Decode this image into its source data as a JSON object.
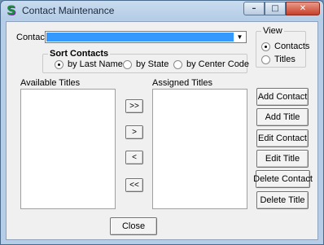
{
  "window": {
    "title": "Contact Maintenance",
    "icon": "S",
    "minimize": "–",
    "maximize": "□",
    "close": "✕"
  },
  "contact": {
    "label": "Contact:",
    "value": ""
  },
  "sort": {
    "legend": "Sort Contacts",
    "options": [
      {
        "label": "by Last Name",
        "selected": true
      },
      {
        "label": "by State",
        "selected": false
      },
      {
        "label": "by Center Code",
        "selected": false
      }
    ]
  },
  "view": {
    "legend": "View",
    "options": [
      {
        "label": "Contacts",
        "selected": true
      },
      {
        "label": "Titles",
        "selected": false
      }
    ]
  },
  "lists": {
    "available_label": "Available Titles",
    "assigned_label": "Assigned Titles"
  },
  "transfer": {
    "add_all": ">>",
    "add": ">",
    "remove": "<",
    "remove_all": "<<"
  },
  "actions": {
    "add_contact": "Add Contact",
    "add_title": "Add Title",
    "edit_contact": "Edit Contact",
    "edit_title": "Edit Title",
    "delete_contact": "Delete Contact",
    "delete_title": "Delete Title"
  },
  "footer": {
    "close": "Close"
  }
}
